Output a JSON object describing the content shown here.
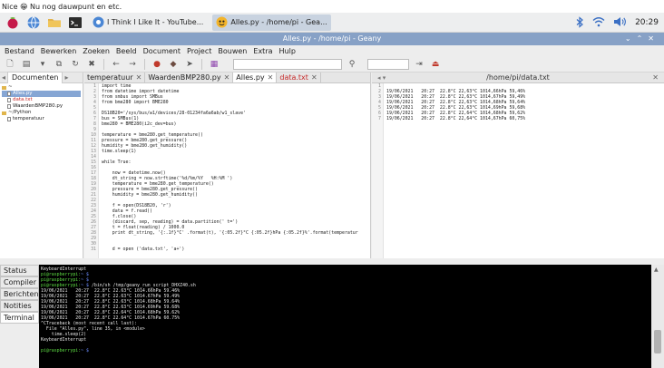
{
  "caption": "Nice 😁 Nu nog dauwpunt en etc.",
  "taskbar": {
    "tasks": [
      {
        "label": "I Think I Like It - YouTube...",
        "active": false
      },
      {
        "label": "Alles.py - /home/pi - Gea...",
        "active": true
      }
    ],
    "clock": "20:29"
  },
  "window": {
    "title": "Alles.py - /home/pi - Geany",
    "menu": [
      "Bestand",
      "Bewerken",
      "Zoeken",
      "Beeld",
      "Document",
      "Project",
      "Bouwen",
      "Extra",
      "Hulp"
    ]
  },
  "sidebar": {
    "tab": "Documenten",
    "tree": [
      {
        "label": "~",
        "kind": "folder",
        "indent": 0,
        "selected": false,
        "red": false
      },
      {
        "label": "Alles.py",
        "kind": "doc",
        "indent": 1,
        "selected": true,
        "red": false
      },
      {
        "label": "data.txt",
        "kind": "doc",
        "indent": 1,
        "selected": false,
        "red": true
      },
      {
        "label": "WaardenBMP280.py",
        "kind": "doc",
        "indent": 1,
        "selected": false,
        "red": false
      },
      {
        "label": "~/Python",
        "kind": "folder",
        "indent": 0,
        "selected": false,
        "red": false
      },
      {
        "label": "temperatuur",
        "kind": "doc",
        "indent": 1,
        "selected": false,
        "red": false
      }
    ]
  },
  "editor": {
    "tabs": [
      {
        "label": "temperatuur",
        "active": false,
        "red": false
      },
      {
        "label": "WaardenBMP280.py",
        "active": false,
        "red": false
      },
      {
        "label": "Alles.py",
        "active": true,
        "red": false
      },
      {
        "label": "data.txt",
        "active": false,
        "red": true
      }
    ],
    "lines": [
      "import time",
      "from datetime import datetime",
      "from smbus import SMBus",
      "from bme280 import BME280",
      "",
      "DS18B20='/sys/bus/w1/devices/28-01234fa6a6ab/w1_slave'",
      "bus = SMBus(1)",
      "bme280 = BME280(i2c_dev=bus)",
      "",
      "temperature = bme280.get_temperature()",
      "pressure = bme280.get_pressure()",
      "humidity = bme280.get_humidity()",
      "time.sleep(1)",
      "",
      "while True:",
      "",
      "    now = datetime.now()",
      "    dt_string = now.strftime('%d/%m/%Y   %H:%M ')",
      "    temperature = bme280.get_temperature()",
      "    pressure = bme280.get_pressure()",
      "    humidity = bme280.get_humidity()",
      "",
      "    f = open(DS18B20, 'r')",
      "    data = f.read()",
      "    f.close()",
      "    (discard, sep, reading) = data.partition(' t=')",
      "    t = float(reading) / 1000.0",
      "    print dt_string, '{:.1f}°C' .format(t), '{:05.2f}°C {:05.2f}hPa {:05.2f}%'.format(temperatur",
      "",
      "",
      "    d = open ('data.txt', 'a+')"
    ]
  },
  "rightpane": {
    "title": "/home/pi/data.txt",
    "lines": [
      "",
      "19/06/2021   20:27  22.8°C 22,63°C 1014,66hPa 59,46%",
      "19/06/2021   20:27  22.8°C 22,63°C 1014,67hPa 59,49%",
      "19/06/2021   20:27  22.8°C 22,63°C 1014,68hPa 59,64%",
      "19/06/2021   20:27  22.8°C 22,63°C 1014,69hPa 59,68%",
      "19/06/2021   20:27  22.8°C 22,64°C 1014,68hPa 59,62%",
      "19/06/2021   20:27  22.8°C 22,64°C 1014,67hPa 60,75%"
    ]
  },
  "bottom": {
    "tabs": [
      "Status",
      "Compiler",
      "Berichten",
      "Notities",
      "Terminal"
    ],
    "active": "Terminal",
    "terminal": [
      {
        "prompt": "",
        "text": "KeyboardInterrupt"
      },
      {
        "prompt": "pi@raspberrypi:~ $",
        "text": ""
      },
      {
        "prompt": "pi@raspberrypi:~ $",
        "text": ""
      },
      {
        "prompt": "pi@raspberrypi:~ $",
        "text": " /bin/sh /tmp/geany_run_script_DHXZ40.sh"
      },
      {
        "prompt": "",
        "text": "19/06/2021   20:27  22.8°C 22.63°C 1014.66hPa 59.46%"
      },
      {
        "prompt": "",
        "text": "19/06/2021   20:27  22.8°C 22.63°C 1014.67hPa 59.49%"
      },
      {
        "prompt": "",
        "text": "19/06/2021   20:27  22.8°C 22.63°C 1014.68hPa 59.64%"
      },
      {
        "prompt": "",
        "text": "19/06/2021   20:27  22.8°C 22.63°C 1014.69hPa 59.68%"
      },
      {
        "prompt": "",
        "text": "19/06/2021   20:27  22.8°C 22.64°C 1014.68hPa 59.62%"
      },
      {
        "prompt": "",
        "text": "19/06/2021   20:27  22.8°C 22.64°C 1014.67hPa 60.75%"
      },
      {
        "prompt": "",
        "text": "^CTraceback (most recent call last):"
      },
      {
        "prompt": "",
        "text": "  File \"Alles.py\", line 35, in <module>"
      },
      {
        "prompt": "",
        "text": "    time.sleep(2)"
      },
      {
        "prompt": "",
        "text": "KeyboardInterrupt"
      },
      {
        "prompt": "",
        "text": ""
      },
      {
        "prompt": "pi@raspberrypi:~ $",
        "text": ""
      }
    ]
  },
  "icons": {
    "raspberry": "raspberry-icon",
    "browser": "globe-icon",
    "files": "folder-icon",
    "terminal": "terminal-icon",
    "bluetooth": "bluetooth-icon",
    "wifi": "wifi-icon",
    "volume": "volume-icon"
  }
}
